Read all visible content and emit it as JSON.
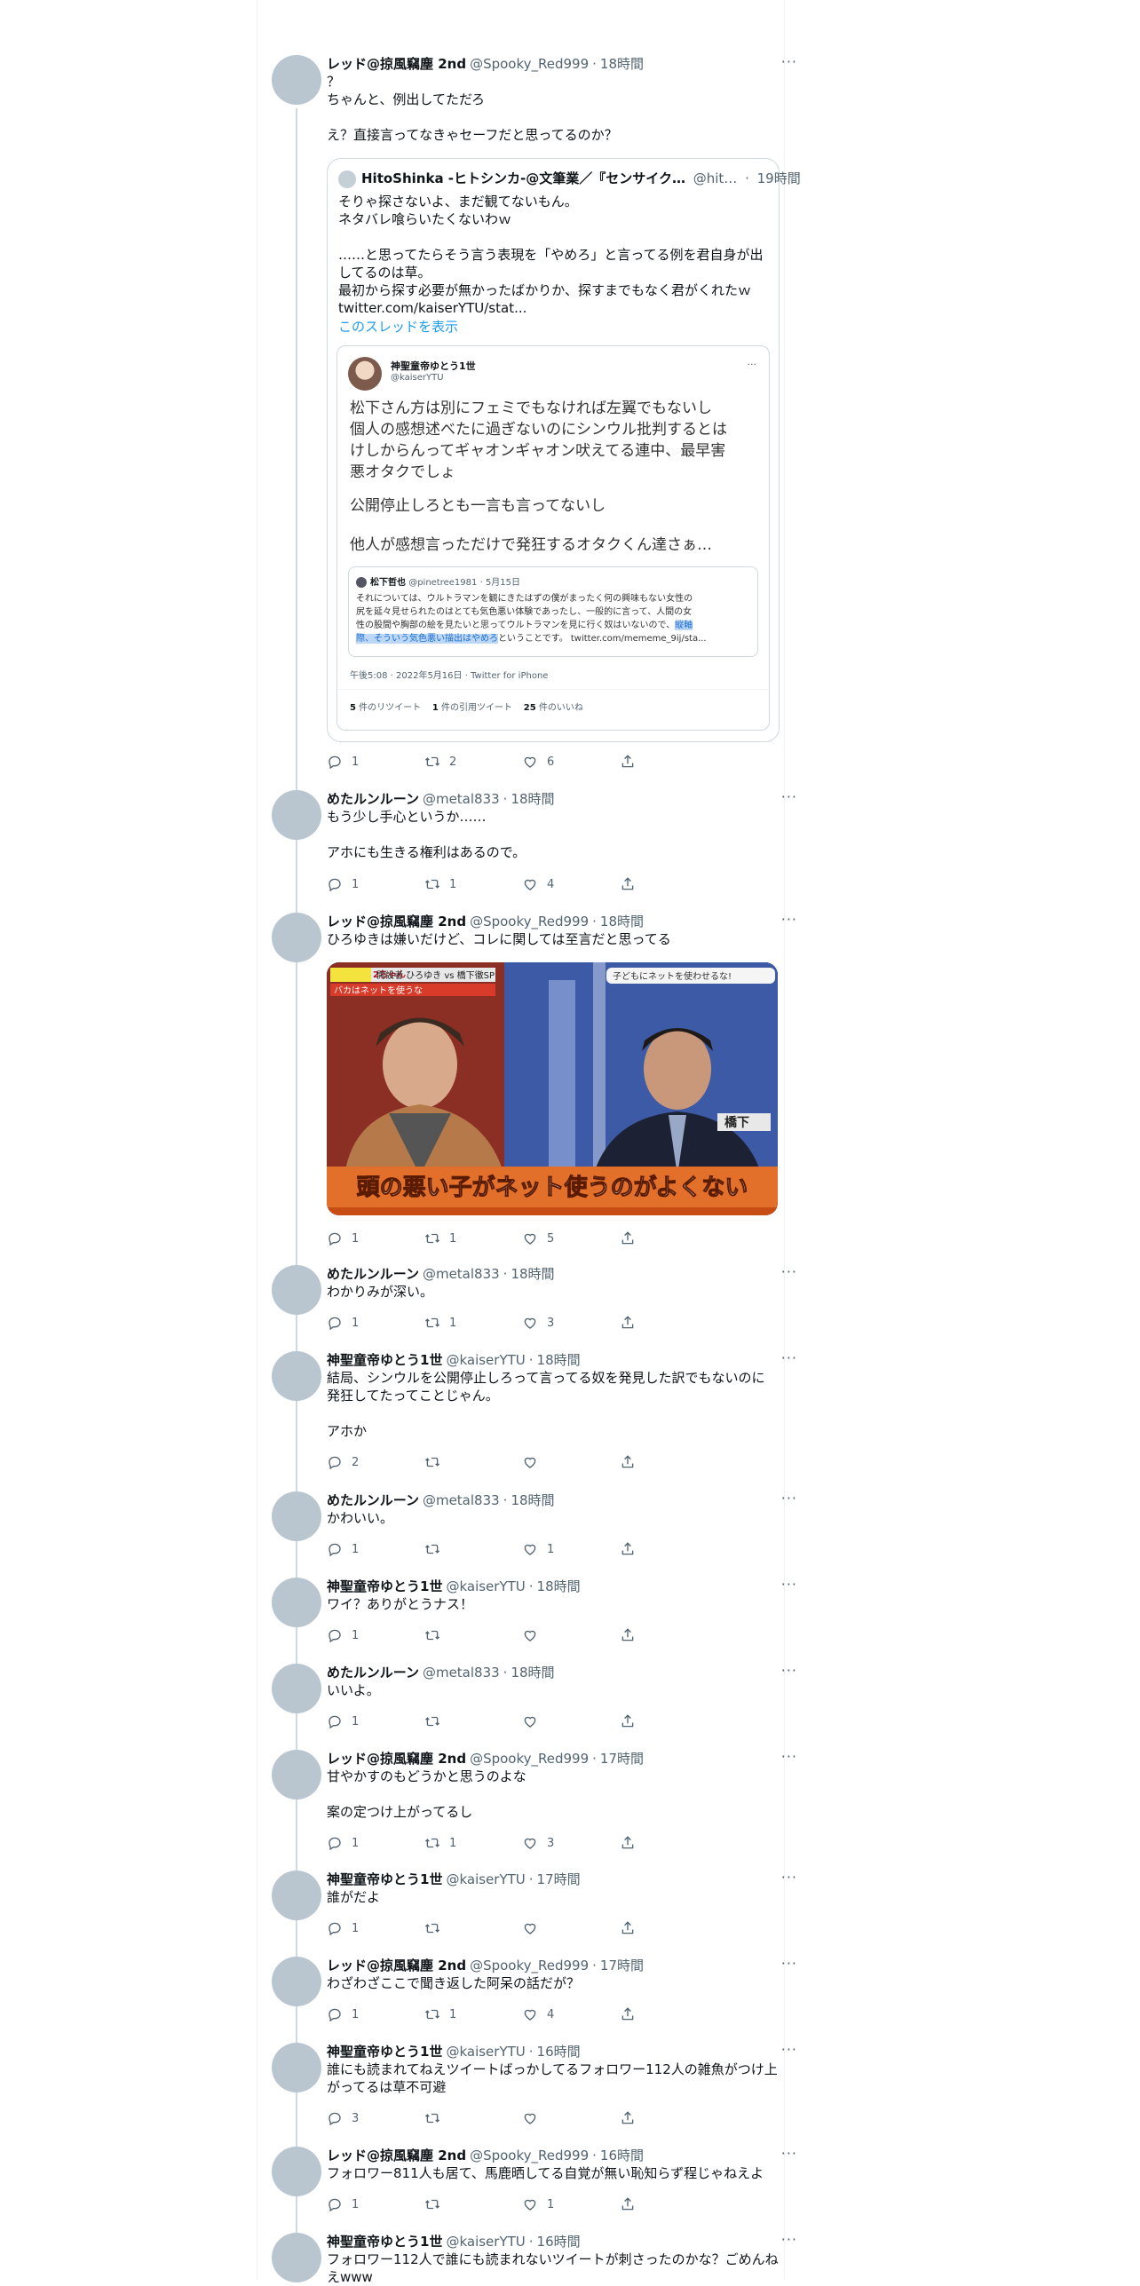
{
  "icons": {
    "reply": "reply-icon",
    "retweet": "retweet-icon",
    "like": "heart-icon",
    "share": "share-icon",
    "more": "more-icon"
  },
  "colors": {
    "text": "#0f1419",
    "secondary": "#536471",
    "link": "#1d9bf0",
    "line": "#cfd9de",
    "avatar": "#b9c6d0"
  },
  "tweets": [
    {
      "name": "レッド@掠風竊塵 2nd",
      "handle": "@Spooky_Red999",
      "time": "18時間",
      "text": "？\nちゃんと、例出してただろ\n\nえ？直接言ってなきゃセーフだと思ってるのか？",
      "reply": "1",
      "retweet": "2",
      "like": "6"
    },
    {
      "name": "めたルンルーン",
      "handle": "@metal833",
      "time": "18時間",
      "text": "もう少し手心というか……\n\nアホにも生きる権利はあるので。",
      "reply": "1",
      "retweet": "1",
      "like": "4"
    },
    {
      "name": "レッド@掠風竊塵 2nd",
      "handle": "@Spooky_Red999",
      "time": "18時間",
      "text": "ひろゆきは嫌いだけど、コレに関しては至言だと思ってる",
      "reply": "1",
      "retweet": "1",
      "like": "5"
    },
    {
      "name": "めたルンルーン",
      "handle": "@metal833",
      "time": "18時間",
      "text": "わかりみが深い。",
      "reply": "1",
      "retweet": "1",
      "like": "3"
    },
    {
      "name": "神聖童帝ゆとう1世",
      "handle": "@kaiserYTU",
      "time": "18時間",
      "text": "結局、シンウルを公開停止しろって言ってる奴を発見した訳でもないのに\n発狂してたってことじゃん。\n\nアホか",
      "reply": "2",
      "retweet": "",
      "like": ""
    },
    {
      "name": "めたルンルーン",
      "handle": "@metal833",
      "time": "18時間",
      "text": "かわいい。",
      "reply": "1",
      "retweet": "",
      "like": "1"
    },
    {
      "name": "神聖童帝ゆとう1世",
      "handle": "@kaiserYTU",
      "time": "18時間",
      "text": "ワイ？ありがとうナス！",
      "reply": "1",
      "retweet": "",
      "like": ""
    },
    {
      "name": "めたルンルーン",
      "handle": "@metal833",
      "time": "18時間",
      "text": "いいよ。",
      "reply": "1",
      "retweet": "",
      "like": ""
    },
    {
      "name": "レッド@掠風竊塵 2nd",
      "handle": "@Spooky_Red999",
      "time": "17時間",
      "text": "甘やかすのもどうかと思うのよな\n\n案の定つけ上がってるし",
      "reply": "1",
      "retweet": "1",
      "like": "3"
    },
    {
      "name": "神聖童帝ゆとう1世",
      "handle": "@kaiserYTU",
      "time": "17時間",
      "text": "誰がだよ",
      "reply": "1",
      "retweet": "",
      "like": ""
    },
    {
      "name": "レッド@掠風竊塵 2nd",
      "handle": "@Spooky_Red999",
      "time": "17時間",
      "text": "わざわざここで聞き返した阿呆の話だが？",
      "reply": "1",
      "retweet": "1",
      "like": "4"
    },
    {
      "name": "神聖童帝ゆとう1世",
      "handle": "@kaiserYTU",
      "time": "16時間",
      "text": "誰にも読まれてねえツイートばっかしてるフォロワー112人の雑魚がつけ上\nがってるは草不可避",
      "reply": "3",
      "retweet": "",
      "like": ""
    },
    {
      "name": "レッド@掠風竊塵 2nd",
      "handle": "@Spooky_Red999",
      "time": "16時間",
      "text": "フォロワー811人も居て、馬鹿晒してる自覚が無い恥知らず程じゃねえよ",
      "reply": "1",
      "retweet": "",
      "like": "1"
    },
    {
      "name": "神聖童帝ゆとう1世",
      "handle": "@kaiserYTU",
      "time": "16時間",
      "text": "フォロワー112人で誰にも読まれないツイートが刺さったのかな？ごめんね\nえwww"
    }
  ],
  "quote": {
    "name": "HitoShinka -ヒトシンカ-@文筆業／『センサイク…",
    "handle": "@hit…",
    "time": "19時間",
    "text": "そりゃ探さないよ、まだ観てないもん。\nネタバレ喰らいたくないわｗ\n\n……と思ってたらそう言う表現を「やめろ」と言ってる例を君自身が出\nしてるのは草。\n最初から探す必要が無かったばかりか、探すまでもなく君がくれたｗ\ntwitter.com/kaiserYTU/stat...",
    "show_thread": "このスレッドを表示"
  },
  "embedded": {
    "name": "神聖童帝ゆとう1世",
    "handle": "@kaiserYTU",
    "text1": "松下さん方は別にフェミでもなければ左翼でもないし\n個人の感想述べたに過ぎないのにシンウル批判するとは\nけしからんってギャオンギャオン吠えてる連中、最早害\n悪オタクでしょ",
    "text2": "公開停止しろとも一言も言ってないし",
    "text3": "他人が感想言っただけで発狂するオタクくん達さぁ…",
    "timestamp": "午後5:08 · 2022年5月16日 · Twitter for iPhone",
    "retweets_num": "5",
    "retweets_label": "件のリツイート",
    "quotes_num": "1",
    "quotes_label": "件の引用ツイート",
    "likes_num": "25",
    "likes_label": "件のいいね"
  },
  "nested": {
    "name": "松下哲也",
    "handle": "@pinetree1981",
    "date": "5月15日",
    "line1": "それについては、ウルトラマンを観にきたはずの僕がまったく何の興味もない女性の",
    "line2": "尻を延々見せられたのはとても気色悪い体験であったし、一般的に言って、人間の女",
    "line3a": "性の股間や胸部の絵を見たいと思ってウルトラマンを見に行く奴はいないので、",
    "line3b": "縦軸",
    "line4a": "際、そういう気色悪い描出はやめろ",
    "line4b": "ということです。 twitter.com/mememe_9ij/sta..."
  },
  "image": {
    "badge": "2ちゃん",
    "headline": "開設者 ひろゆき vs 橋下徹SP",
    "subline": "バカはネットを使うな",
    "corner": "子どもにネットを使わせるな!",
    "nameplate": "橋下",
    "caption": "頭の悪い子がネット使うのがよくない"
  }
}
